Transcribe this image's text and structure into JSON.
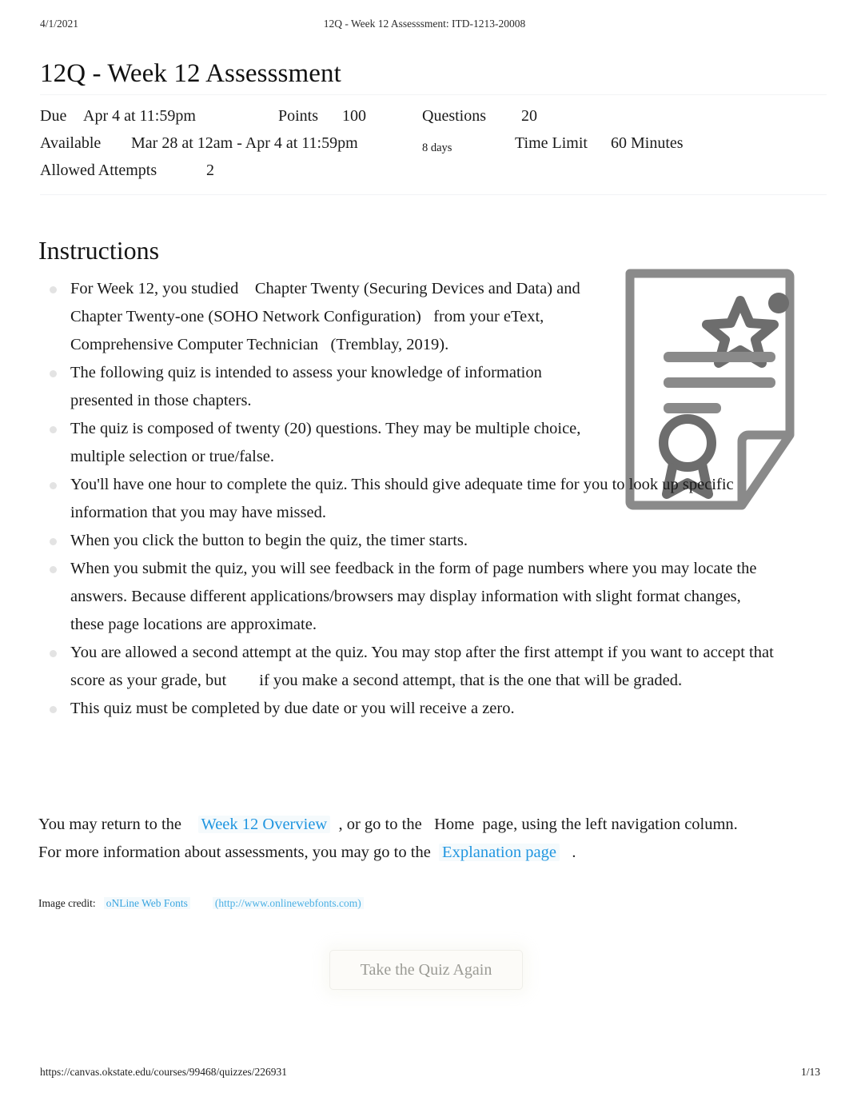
{
  "print_header": {
    "date": "4/1/2021",
    "document_title": "12Q - Week 12 Assesssment: ITD-1213-20008"
  },
  "page_title": "12Q - Week 12 Assesssment",
  "quiz_meta": {
    "due_label": "Due",
    "due_value": "Apr 4 at 11:59pm",
    "points_label": "Points",
    "points_value": "100",
    "questions_label": "Questions",
    "questions_value": "20",
    "available_label": "Available",
    "available_value": "Mar 28 at 12am - Apr 4 at 11:59pm",
    "available_duration": "8 days",
    "time_limit_label": "Time Limit",
    "time_limit_value": "60 Minutes",
    "allowed_attempts_label": "Allowed Attempts",
    "allowed_attempts_value": "2"
  },
  "instructions": {
    "heading": "Instructions",
    "image_name": "certificate-icon",
    "items": [
      {
        "text_before": "For Week 12, you studied",
        "emphasis": "Chapter Twenty (Securing Devices and Data) and Chapter Twenty-one (SOHO Network Configuration)",
        "text_middle": "from your eText,",
        "emphasis2": "Comprehensive Computer Technician",
        "text_after": "(Tremblay, 2019)."
      },
      {
        "text": "The following quiz is intended to assess your knowledge of information presented in those chapters."
      },
      {
        "text": "The quiz is composed of twenty (20) questions. They may be multiple choice, multiple selection or true/false."
      },
      {
        "text": "You'll have one hour to complete the quiz. This should give adequate time for you to look up specific information that you may have missed."
      },
      {
        "text": "When you click the button to begin the quiz, the timer starts."
      },
      {
        "text": "When you submit the quiz, you will see feedback in the form of page numbers where you may locate the answers. Because different applications/browsers may display information with slight format changes, these page locations are approximate."
      },
      {
        "text_before": "You are allowed a second attempt at the quiz. You may stop after the first attempt if you want to accept that score as your grade, but",
        "emphasis": "if you make a second attempt, that is the one that will be graded."
      },
      {
        "text": "This quiz must be completed by due date or you will receive a zero."
      }
    ]
  },
  "closing_paragraph": {
    "part1": "You may return to the",
    "link1": "Week 12 Overview",
    "part2": ", or go to the",
    "home_word": "Home",
    "part3": "page, using the left navigation column. For more information about assessments, you may go to the",
    "link2": "Explanation page",
    "part4": "."
  },
  "image_credit": {
    "label": "Image credit:",
    "link_text": "oNLine Web Fonts",
    "url_text": "(http://www.onlinewebfonts.com)"
  },
  "quiz_button": {
    "label": "Take the Quiz Again"
  },
  "print_footer": {
    "url": "https://canvas.okstate.edu/courses/99468/quizzes/226931",
    "page_number": "1/13"
  },
  "colors": {
    "link": "#2196e0",
    "credit_link": "#3aa5e0",
    "button_text": "#9b9b95",
    "rule": "#f2f3f5",
    "bullet": "#e3e3e3",
    "icon": "#8a8a8a"
  }
}
